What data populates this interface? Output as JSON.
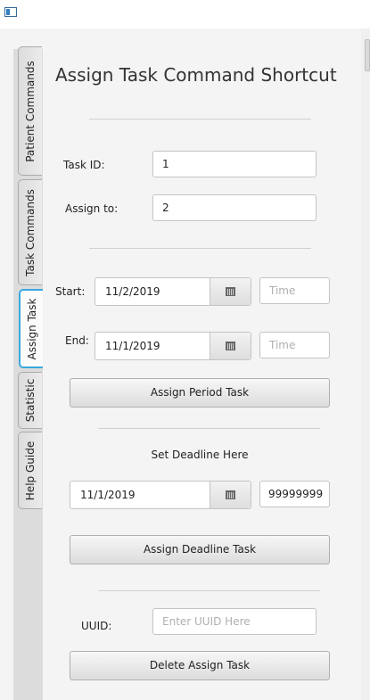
{
  "window": {
    "icon": "app-window-icon"
  },
  "tabs": [
    {
      "label": "Patient Commands",
      "active": false
    },
    {
      "label": "Task Commands",
      "active": false
    },
    {
      "label": "Assign Task",
      "active": true
    },
    {
      "label": "Statistic",
      "active": false
    },
    {
      "label": "Help Guide",
      "active": false
    }
  ],
  "main": {
    "title": "Assign Task Command Shortcut",
    "task_id": {
      "label": "Task ID:",
      "value": "1"
    },
    "assign_to": {
      "label": "Assign to:",
      "value": "2"
    },
    "start": {
      "label": "Start:",
      "date": "11/2/2019",
      "time_placeholder": "Time",
      "calendar_icon": "calendar-icon"
    },
    "end": {
      "label": "End:",
      "date": "11/1/2019",
      "time_placeholder": "Time",
      "calendar_icon": "calendar-icon"
    },
    "assign_period_button": "Assign Period Task",
    "deadline_heading": "Set  Deadline Here",
    "deadline": {
      "date": "11/1/2019",
      "time_value": "99999999"
    },
    "assign_deadline_button": "Assign Deadline Task",
    "uuid": {
      "label": "UUID:",
      "placeholder": "Enter UUID Here"
    },
    "delete_button": "Delete Assign Task"
  }
}
